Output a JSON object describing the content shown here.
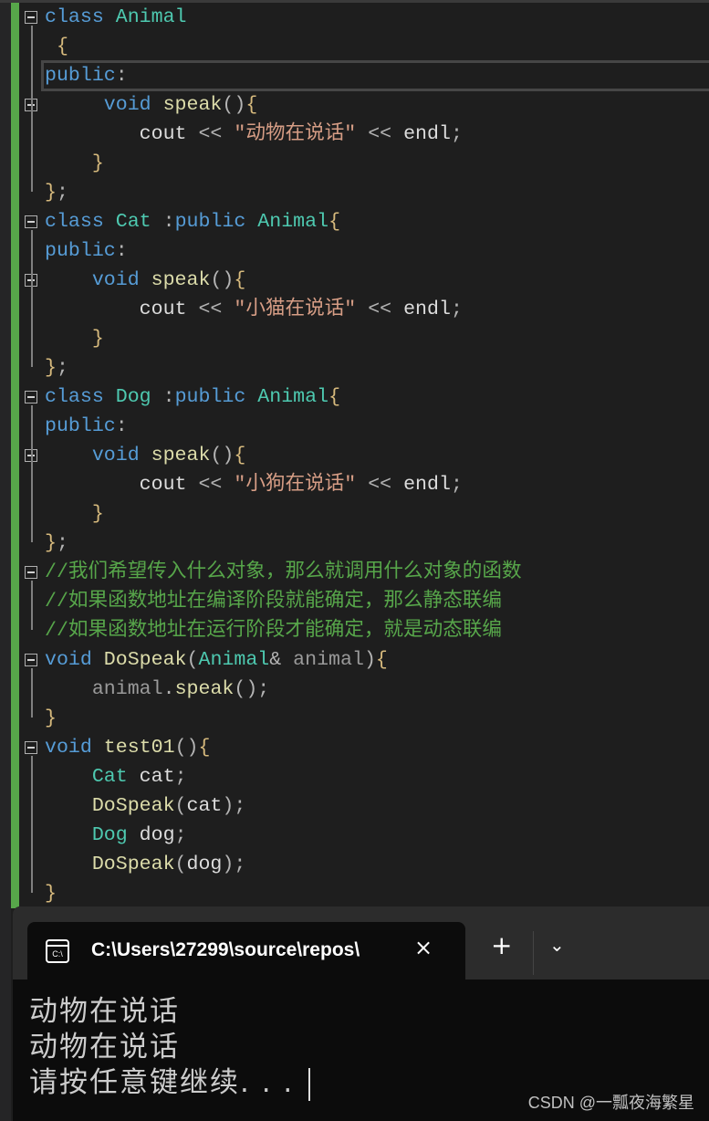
{
  "editor": {
    "current_line": 2,
    "fold_lines": [
      0,
      3,
      7,
      9,
      13,
      15,
      19,
      22,
      25
    ],
    "lines": [
      [
        [
          "kw",
          "class "
        ],
        [
          "ty",
          "Animal"
        ]
      ],
      [
        [
          "br",
          " {"
        ]
      ],
      [
        [
          "kw",
          "public"
        ],
        [
          "pu",
          ":"
        ]
      ],
      [
        [
          "tx",
          "     "
        ],
        [
          "kw",
          "void "
        ],
        [
          "fn",
          "speak"
        ],
        [
          "pu",
          "()"
        ],
        [
          "br",
          "{"
        ]
      ],
      [
        [
          "tx",
          "        cout "
        ],
        [
          "pu",
          "<< "
        ],
        [
          "st",
          "\"动物在说话\""
        ],
        [
          "pu",
          " << "
        ],
        [
          "tx",
          "endl"
        ],
        [
          "pu",
          ";"
        ]
      ],
      [
        [
          "br",
          "    }"
        ]
      ],
      [
        [
          "br",
          "}"
        ],
        [
          "pu",
          ";"
        ]
      ],
      [
        [
          "kw",
          "class "
        ],
        [
          "ty",
          "Cat"
        ],
        [
          "pu",
          " :"
        ],
        [
          "kw",
          "public "
        ],
        [
          "ty",
          "Animal"
        ],
        [
          "br",
          "{"
        ]
      ],
      [
        [
          "kw",
          "public"
        ],
        [
          "pu",
          ":"
        ]
      ],
      [
        [
          "tx",
          "    "
        ],
        [
          "kw",
          "void "
        ],
        [
          "fn",
          "speak"
        ],
        [
          "pu",
          "()"
        ],
        [
          "br",
          "{"
        ]
      ],
      [
        [
          "tx",
          "        cout "
        ],
        [
          "pu",
          "<< "
        ],
        [
          "st",
          "\"小猫在说话\""
        ],
        [
          "pu",
          " << "
        ],
        [
          "tx",
          "endl"
        ],
        [
          "pu",
          ";"
        ]
      ],
      [
        [
          "br",
          "    }"
        ]
      ],
      [
        [
          "br",
          "}"
        ],
        [
          "pu",
          ";"
        ]
      ],
      [
        [
          "kw",
          "class "
        ],
        [
          "ty",
          "Dog"
        ],
        [
          "pu",
          " :"
        ],
        [
          "kw",
          "public "
        ],
        [
          "ty",
          "Animal"
        ],
        [
          "br",
          "{"
        ]
      ],
      [
        [
          "kw",
          "public"
        ],
        [
          "pu",
          ":"
        ]
      ],
      [
        [
          "tx",
          "    "
        ],
        [
          "kw",
          "void "
        ],
        [
          "fn",
          "speak"
        ],
        [
          "pu",
          "()"
        ],
        [
          "br",
          "{"
        ]
      ],
      [
        [
          "tx",
          "        cout "
        ],
        [
          "pu",
          "<< "
        ],
        [
          "st",
          "\"小狗在说话\""
        ],
        [
          "pu",
          " << "
        ],
        [
          "tx",
          "endl"
        ],
        [
          "pu",
          ";"
        ]
      ],
      [
        [
          "br",
          "    }"
        ]
      ],
      [
        [
          "br",
          "}"
        ],
        [
          "pu",
          ";"
        ]
      ],
      [
        [
          "cm",
          "//我们希望传入什么对象，那么就调用什么对象的函数"
        ]
      ],
      [
        [
          "cm",
          "//如果函数地址在编译阶段就能确定，那么静态联编"
        ]
      ],
      [
        [
          "cm",
          "//如果函数地址在运行阶段才能确定，就是动态联编"
        ]
      ],
      [
        [
          "kw",
          "void "
        ],
        [
          "fn",
          "DoSpeak"
        ],
        [
          "pu",
          "("
        ],
        [
          "ty",
          "Animal"
        ],
        [
          "pu",
          "& "
        ],
        [
          "pa",
          "animal"
        ],
        [
          "pu",
          ")"
        ],
        [
          "br",
          "{"
        ]
      ],
      [
        [
          "pa",
          "    animal"
        ],
        [
          "pu",
          "."
        ],
        [
          "fn",
          "speak"
        ],
        [
          "pu",
          "();"
        ]
      ],
      [
        [
          "br",
          "}"
        ]
      ],
      [
        [
          "kw",
          "void "
        ],
        [
          "fn",
          "test01"
        ],
        [
          "pu",
          "()"
        ],
        [
          "br",
          "{"
        ]
      ],
      [
        [
          "ty",
          "    Cat "
        ],
        [
          "tx",
          "cat"
        ],
        [
          "pu",
          ";"
        ]
      ],
      [
        [
          "fn",
          "    DoSpeak"
        ],
        [
          "pu",
          "("
        ],
        [
          "tx",
          "cat"
        ],
        [
          "pu",
          ");"
        ]
      ],
      [
        [
          "ty",
          "    Dog "
        ],
        [
          "tx",
          "dog"
        ],
        [
          "pu",
          ";"
        ]
      ],
      [
        [
          "fn",
          "    DoSpeak"
        ],
        [
          "pu",
          "("
        ],
        [
          "tx",
          "dog"
        ],
        [
          "pu",
          ");"
        ]
      ],
      [
        [
          "br",
          "}"
        ]
      ]
    ]
  },
  "terminal": {
    "tab_icon_label": "C:\\",
    "tab_title": "C:\\Users\\27299\\source\\repos\\",
    "close_icon": "×",
    "new_tab_icon": "+",
    "dropdown_icon": "⌄",
    "output": [
      "动物在说话",
      "动物在说话",
      "请按任意键继续. . ."
    ]
  },
  "watermark": "CSDN @一瓢夜海繁星"
}
